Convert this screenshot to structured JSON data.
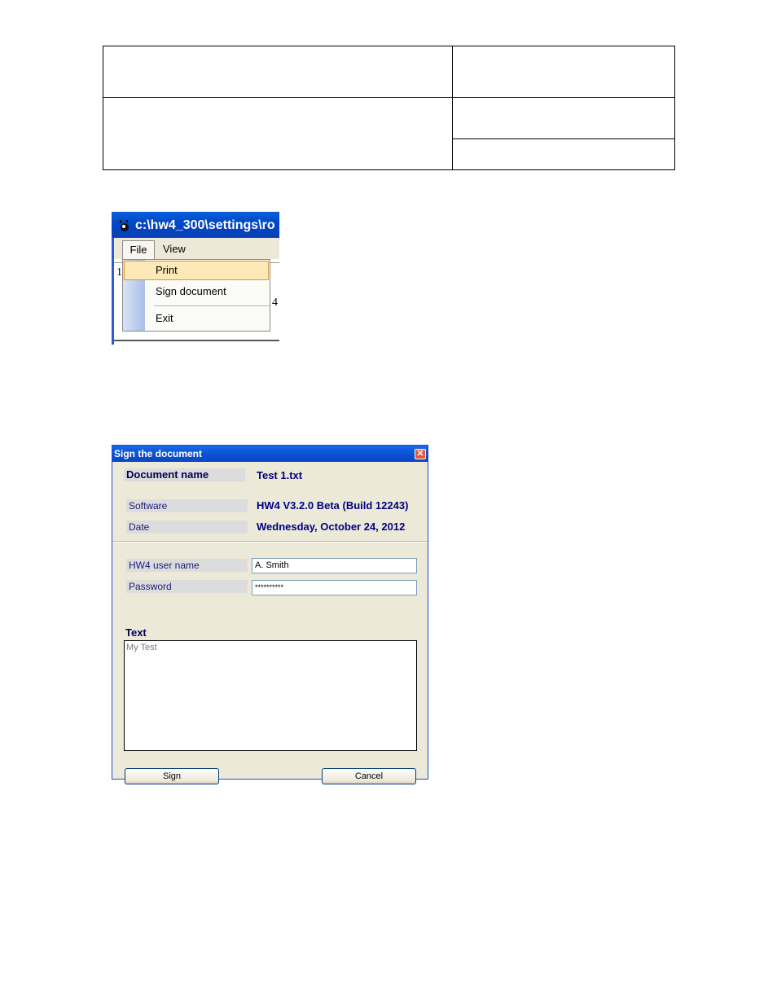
{
  "menu_screenshot": {
    "window_title": "c:\\hw4_300\\settings\\ro",
    "menubar": {
      "file": "File",
      "view": "View"
    },
    "file_menu_items": [
      "Print",
      "Sign document",
      "Exit"
    ],
    "background_fragments": [
      "4",
      "1"
    ]
  },
  "dialog": {
    "title": "Sign the document",
    "close_glyph": "✕",
    "fields": {
      "document_name_label": "Document name",
      "document_name_value": "Test 1.txt",
      "software_label": "Software",
      "software_value": "HW4 V3.2.0 Beta (Build 12243)",
      "date_label": "Date",
      "date_value": "Wednesday, October 24, 2012",
      "user_label": "HW4 user name",
      "user_value": "A. Smith",
      "password_label": "Password",
      "password_value": "**********",
      "text_label": "Text",
      "text_value": "My Test"
    },
    "buttons": {
      "sign": "Sign",
      "cancel": "Cancel"
    },
    "colors": {
      "titlebar": "#0a4fd1",
      "dialog_bg": "#ece9d8",
      "value_text": "#000080"
    }
  }
}
